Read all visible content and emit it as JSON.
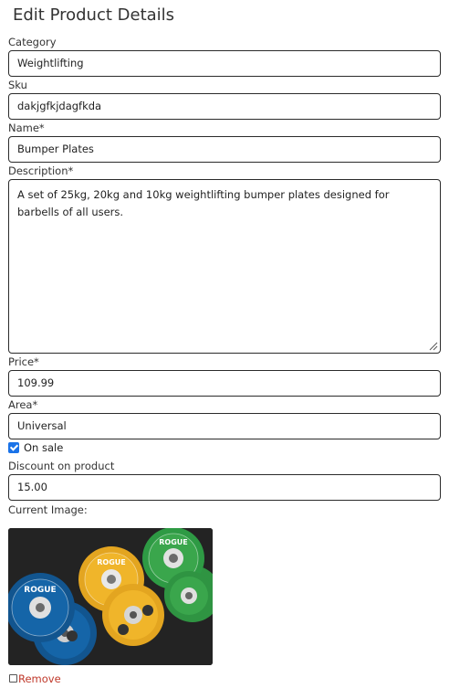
{
  "page_title": "Edit Product Details",
  "fields": {
    "category": {
      "label": "Category",
      "value": "Weightlifting"
    },
    "sku": {
      "label": "Sku",
      "value": "dakjgfkjdagfkda"
    },
    "name": {
      "label": "Name*",
      "value": "Bumper Plates"
    },
    "description": {
      "label": "Description*",
      "value": "A set of 25kg, 20kg and 10kg weightlifting bumper plates designed for barbells of all users."
    },
    "price": {
      "label": "Price*",
      "value": "109.99"
    },
    "area": {
      "label": "Area*",
      "value": "Universal"
    },
    "on_sale": {
      "label": "On sale",
      "checked": true
    },
    "discount": {
      "label": "Discount on product",
      "value": "15.00"
    }
  },
  "current_image": {
    "label": "Current Image:",
    "plate_brand": "ROGUE",
    "remove_label": "Remove",
    "remove_checked": false
  },
  "colors": {
    "remove_text": "#c0392b",
    "checkbox_accent": "#1a73e8",
    "plate_blue": "#1565a8",
    "plate_yellow": "#f0b52a",
    "plate_green": "#3aa64c"
  }
}
